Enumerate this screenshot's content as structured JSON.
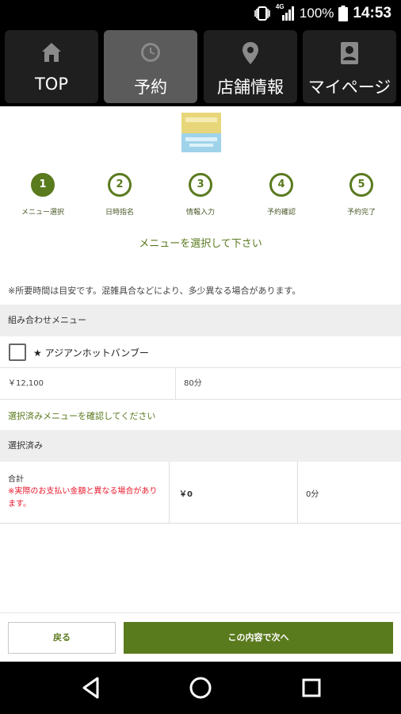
{
  "status_bar": {
    "network": "4G",
    "battery": "100%",
    "time": "14:53"
  },
  "nav": {
    "tabs": [
      {
        "label": "TOP",
        "icon": "home-icon",
        "active": false
      },
      {
        "label": "予約",
        "icon": "clock-icon",
        "active": true
      },
      {
        "label": "店舗情報",
        "icon": "map-pin-icon",
        "active": false
      },
      {
        "label": "マイページ",
        "icon": "user-card-icon",
        "active": false
      }
    ]
  },
  "steps": [
    {
      "number": "1",
      "label": "メニュー選択",
      "current": true
    },
    {
      "number": "2",
      "label": "日時指名",
      "current": false
    },
    {
      "number": "3",
      "label": "情報入力",
      "current": false
    },
    {
      "number": "4",
      "label": "予約確認",
      "current": false
    },
    {
      "number": "5",
      "label": "予約完了",
      "current": false
    }
  ],
  "instruction": "メニューを選択して下さい",
  "note": "※所要時間は目安です。混雑具合などにより、多少異なる場合があります。",
  "combo_section": {
    "title": "組み合わせメニュー",
    "item": {
      "name": "★ アジアンホットバンブー",
      "checked": false,
      "price": "￥12,100",
      "duration": "80分"
    }
  },
  "confirm_text": "選択済みメニューを確認してください",
  "selected_section": {
    "title": "選択済み",
    "total_label": "合計",
    "warning": "※実際のお支払い金額と異なる場合があります。",
    "total_price": "￥0",
    "total_duration": "0分"
  },
  "buttons": {
    "back": "戻る",
    "next": "この内容で次へ"
  },
  "colors": {
    "accent": "#5a7a1e",
    "warning": "#e8192c",
    "nav_active": "#5b5b5b",
    "nav_bg": "#000000"
  }
}
